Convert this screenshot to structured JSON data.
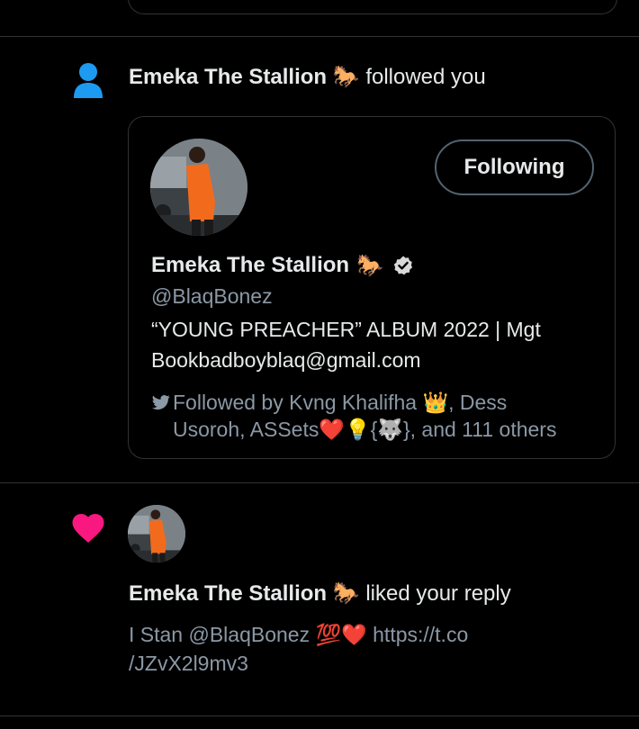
{
  "follow_notification": {
    "user_name": "Emeka The Stallion",
    "user_emoji": "🐎",
    "action": "followed you",
    "icon": "user-icon",
    "card": {
      "button_label": "Following",
      "display_name": "Emeka The Stallion",
      "display_emoji": "🐎",
      "verified_icon": "verified-badge-icon",
      "handle": "@BlaqBonez",
      "bio_line1": "“YOUNG PREACHER” ALBUM 2022 | Mgt",
      "bio_line2": "Bookbadboyblaq@gmail.com",
      "followed_by_icon": "twitter-bird-icon",
      "followed_by_line1": "Followed by Kvng Khalifha 👑, Dess",
      "followed_by_line2": "Usoroh, ASSets❤️💡{🐺}, and 111 others"
    }
  },
  "like_notification": {
    "icon": "heart-icon",
    "user_name": "Emeka The Stallion",
    "user_emoji": "🐎",
    "action": "liked your reply",
    "reply_line1": "I Stan @BlaqBonez 💯❤️ https://t.co",
    "reply_line2": "/JZvX2l9mv3"
  },
  "colors": {
    "background": "#000000",
    "text_primary": "#e7e9ea",
    "text_secondary": "#8b98a5",
    "accent_blue": "#1d9bf0",
    "like_red": "#f91880",
    "border": "#2f3336"
  }
}
